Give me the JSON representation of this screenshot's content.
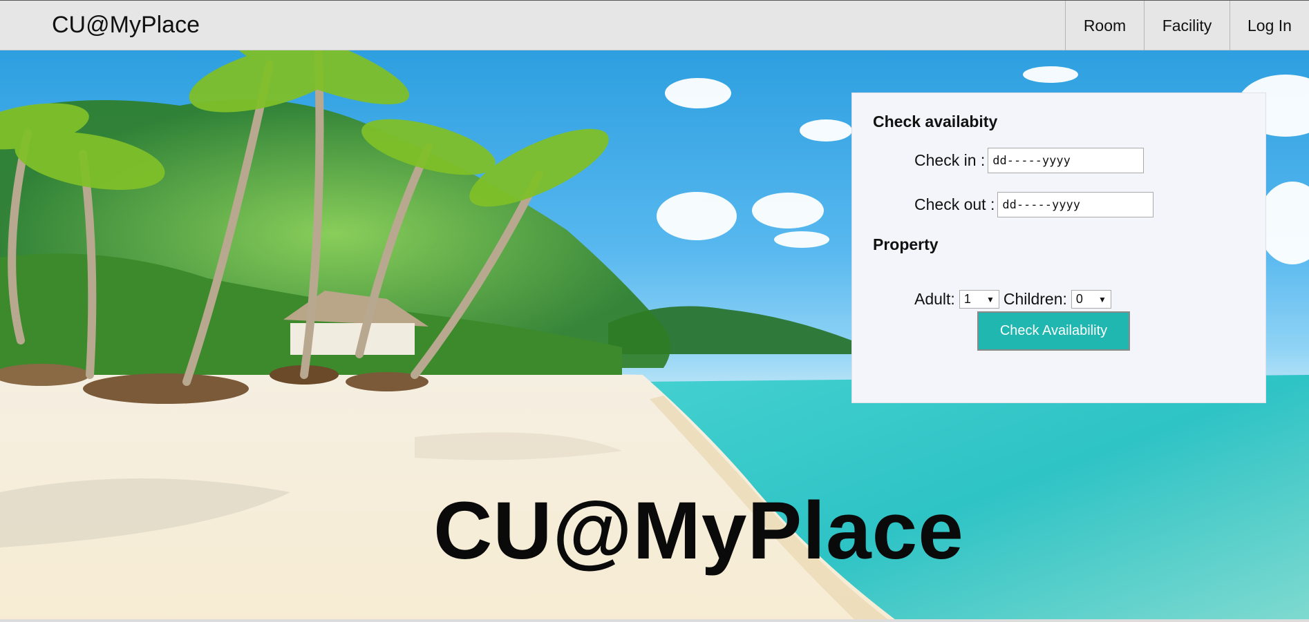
{
  "navbar": {
    "brand": "CU@MyPlace",
    "items": [
      {
        "label": "Room"
      },
      {
        "label": "Facility"
      },
      {
        "label": "Log In"
      }
    ]
  },
  "hero": {
    "title": "CU@MyPlace"
  },
  "booking": {
    "check_heading": "Check availabity",
    "check_in_label": "Check in :",
    "check_in_value": "dd-----yyyy",
    "check_out_label": "Check out :",
    "check_out_value": "dd-----yyyy",
    "property_heading": "Property",
    "adult_label": "Adult:",
    "adult_value": "1",
    "children_label": "Children:",
    "children_value": "0",
    "submit_label": "Check Availability",
    "button_color": "#1fb7b0"
  },
  "icons": {
    "dropdown": "chevron-down-icon"
  }
}
